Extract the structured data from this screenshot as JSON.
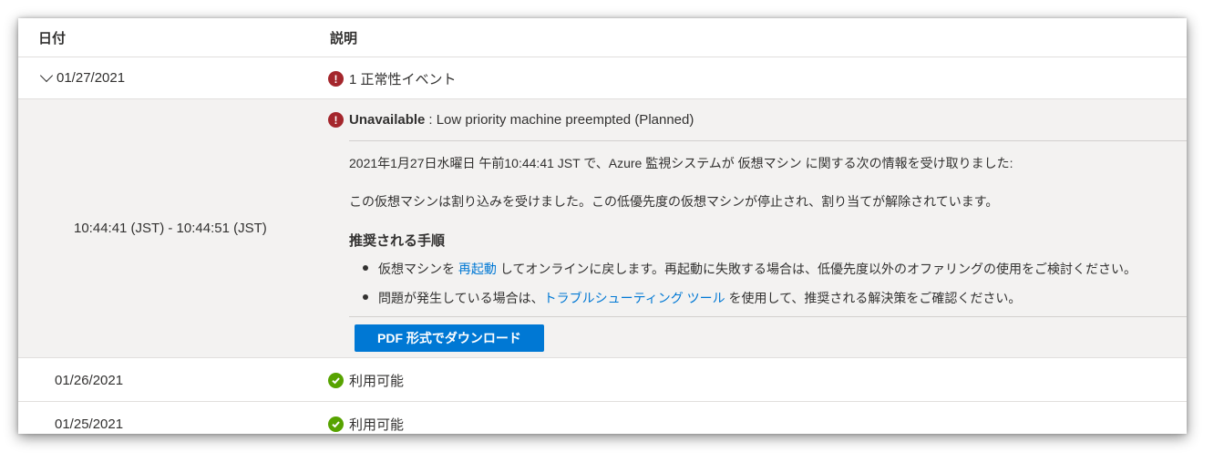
{
  "table": {
    "columns": {
      "date": "日付",
      "description": "説明"
    },
    "group": {
      "date": "01/27/2021",
      "summary": "1 正常性イベント"
    },
    "event": {
      "time_range": "10:44:41 (JST) - 10:44:51 (JST)",
      "status": "Unavailable",
      "title_rest": ": Low priority machine preempted (Planned)",
      "line1": "2021年1月27日水曜日 午前10:44:41 JST で、Azure 監視システムが 仮想マシン に関する次の情報を受け取りました:",
      "line2": "この仮想マシンは割り込みを受けました。この低優先度の仮想マシンが停止され、割り当てが解除されています。",
      "steps_title": "推奨される手順",
      "step1": {
        "prefix": "仮想マシンを ",
        "link": "再起動",
        "suffix": " してオンラインに戻します。再起動に失敗する場合は、低優先度以外のオファリングの使用をご検討ください。"
      },
      "step2": {
        "prefix": "問題が発生している場合は、",
        "link": "トラブルシューティング ツール",
        "suffix": " を使用して、推奨される解決策をご確認ください。"
      },
      "pdf_button": "PDF 形式でダウンロード"
    },
    "rows": [
      {
        "date": "01/26/2021",
        "status": "利用可能"
      },
      {
        "date": "01/25/2021",
        "status": "利用可能"
      }
    ]
  },
  "icons": {
    "error": "error-circle-icon",
    "ok": "checkmark-circle-icon",
    "expand": "chevron-down-icon"
  },
  "colors": {
    "error": "#a4262c",
    "ok": "#57a300",
    "link": "#0078d4",
    "button": "#0078d4",
    "detail_bg": "#f3f2f1"
  }
}
